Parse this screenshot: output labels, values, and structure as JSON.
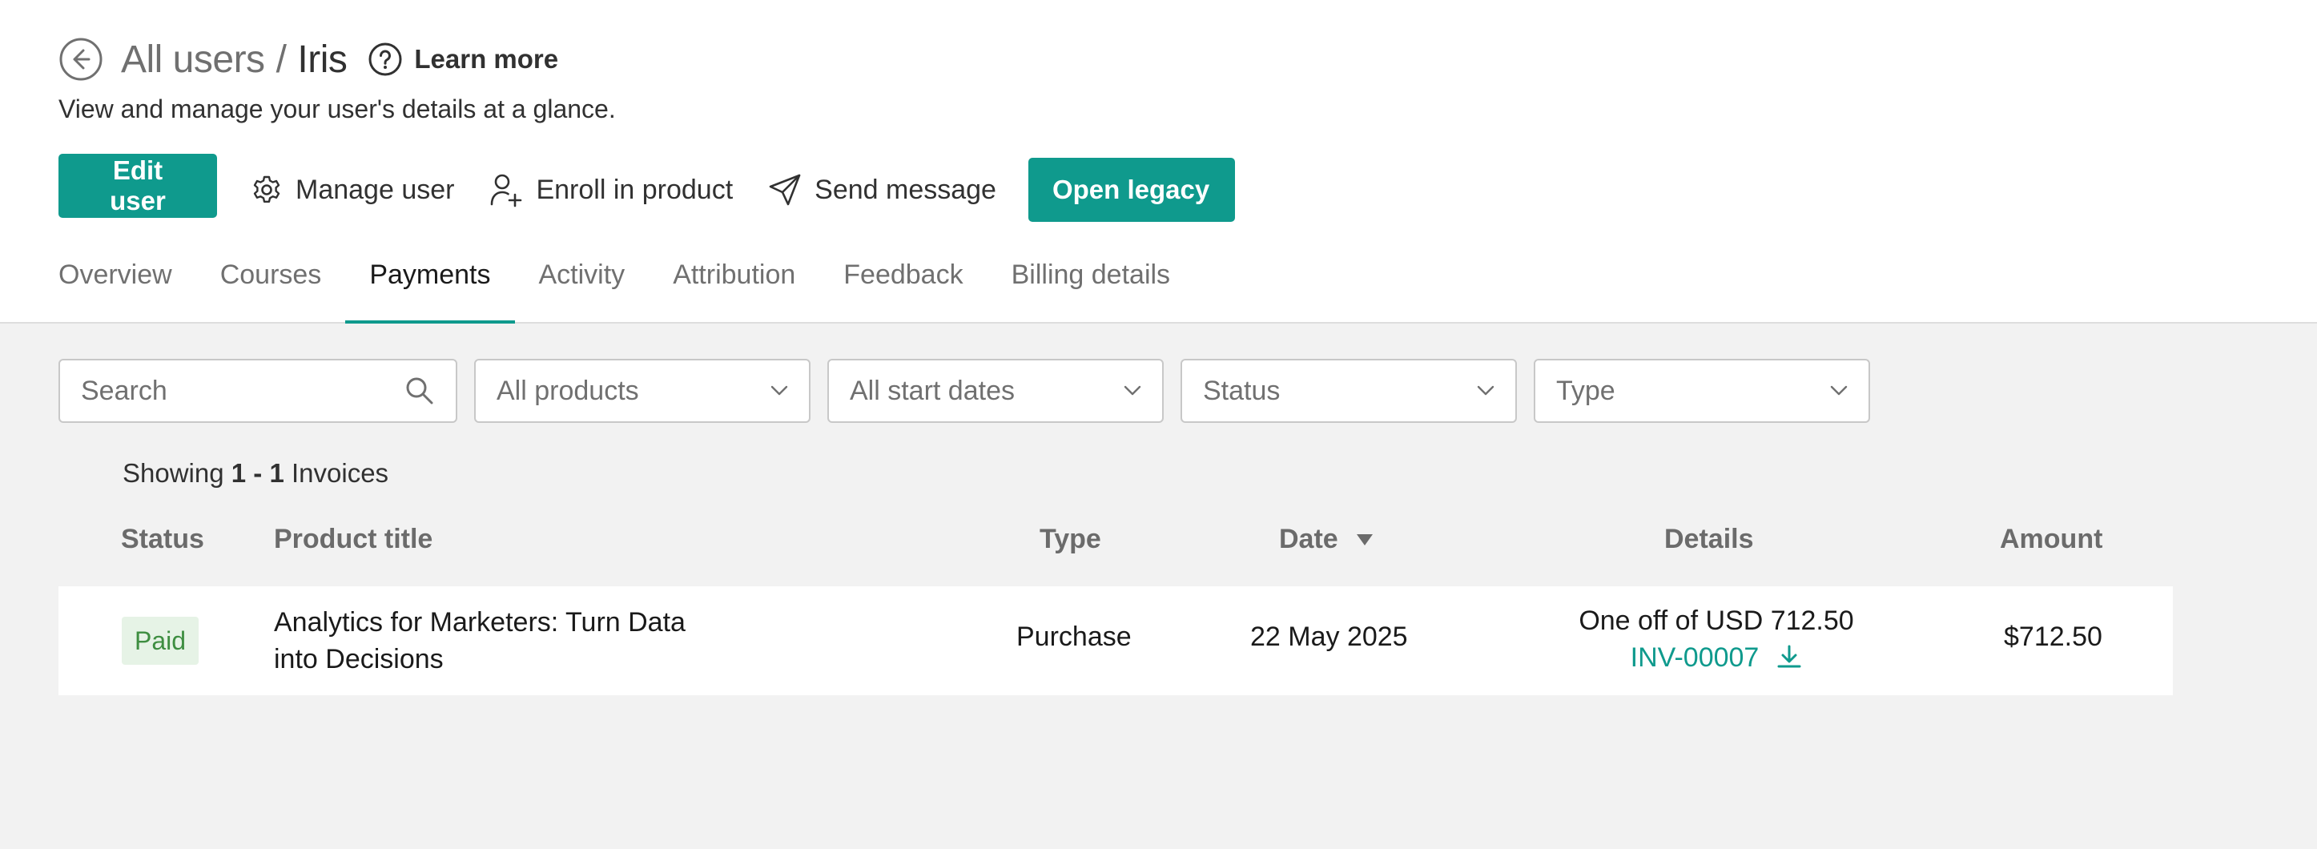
{
  "header": {
    "breadcrumb_parent": "All users",
    "breadcrumb_sep": "/",
    "breadcrumb_current": "Iris",
    "learn_more": "Learn more",
    "subtitle": "View and manage your user's details at a glance."
  },
  "actions": {
    "edit_user": "Edit user",
    "manage_user": "Manage user",
    "enroll_in_product": "Enroll in product",
    "send_message": "Send message",
    "open_legacy": "Open legacy"
  },
  "tabs": [
    {
      "label": "Overview"
    },
    {
      "label": "Courses"
    },
    {
      "label": "Payments",
      "active": true
    },
    {
      "label": "Activity"
    },
    {
      "label": "Attribution"
    },
    {
      "label": "Feedback"
    },
    {
      "label": "Billing details"
    }
  ],
  "filters": {
    "search_placeholder": "Search",
    "products": "All products",
    "start_dates": "All start dates",
    "status": "Status",
    "type": "Type"
  },
  "results": {
    "prefix": "Showing",
    "range": "1 - 1",
    "suffix": "Invoices"
  },
  "table": {
    "columns": {
      "status": "Status",
      "product_title": "Product title",
      "type": "Type",
      "date": "Date",
      "details": "Details",
      "amount": "Amount"
    },
    "rows": [
      {
        "status": "Paid",
        "product_title_line1": "Analytics for Marketers: Turn Data",
        "product_title_line2": "into Decisions",
        "type": "Purchase",
        "date": "22 May 2025",
        "details": "One off of USD 712.50",
        "invoice": "INV-00007",
        "amount": "$712.50"
      }
    ]
  },
  "colors": {
    "accent": "#0f9a8d",
    "paid_badge_bg": "#e6f3e6",
    "paid_badge_text": "#3e8e41",
    "content_bg": "#f2f2f2"
  },
  "icons": {
    "back": "arrow-left-circle-icon",
    "help": "question-circle-icon",
    "manage": "gear-icon",
    "enroll": "user-plus-icon",
    "message": "paper-plane-icon",
    "search": "search-icon",
    "dropdown": "chevron-down-icon",
    "sort": "sort-desc-icon",
    "download": "download-icon"
  }
}
